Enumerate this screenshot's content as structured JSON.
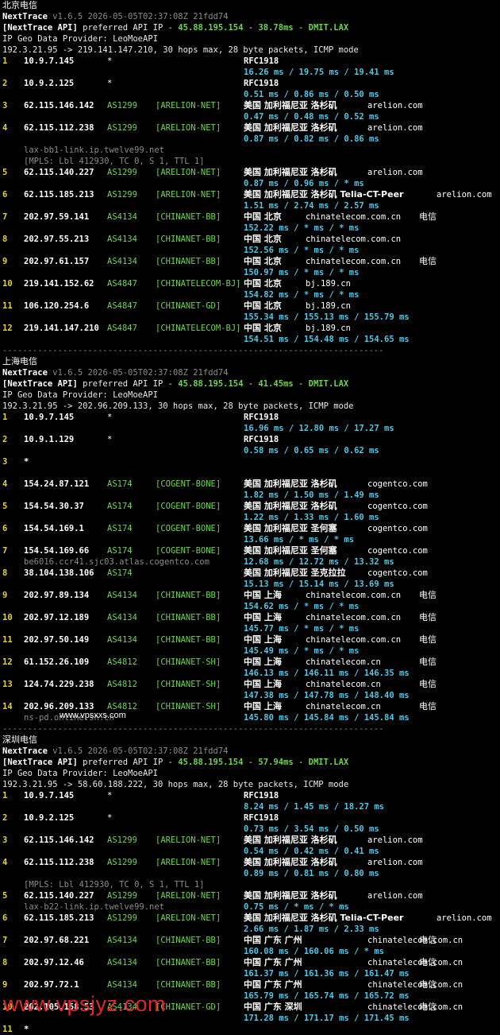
{
  "watermark_top": "www.vpsxxs.com",
  "watermark_bottom": "www.vpsjyz.com",
  "sections": [
    {
      "name": "北京电信",
      "version_line": "v1.6.5 2026-05-05T02:37:08Z 21fdd74",
      "api_ip": "45.88.195.154",
      "api_latency": "38.78ms",
      "api_node": "DMIT.LAX",
      "geo": "IP Geo Data Provider: LeoMoeAPI",
      "target": "192.3.21.95 -> 219.141.147.210, 30 hops max, 28 byte packets, ICMP mode",
      "hops": [
        {
          "n": "1",
          "ip": "10.9.7.145",
          "as": "*",
          "net": "",
          "loc": "RFC1918",
          "dom": "",
          "isp": "",
          "rtt": "16.26 ms / 19.75 ms / 19.41 ms",
          "extra": []
        },
        {
          "n": "2",
          "ip": "10.9.2.125",
          "as": "*",
          "net": "",
          "loc": "RFC1918",
          "dom": "",
          "isp": "",
          "rtt": "0.51 ms / 0.86 ms / 0.50 ms",
          "extra": []
        },
        {
          "n": "3",
          "ip": "62.115.146.142",
          "as": "AS1299",
          "net": "[ARELION-NET]",
          "loc": "美国 加利福尼亚 洛杉矶",
          "dom": "arelion.com",
          "isp": "",
          "rtt": "0.47 ms / 0.48 ms / 0.52 ms",
          "extra": []
        },
        {
          "n": "4",
          "ip": "62.115.112.238",
          "as": "AS1299",
          "net": "[ARELION-NET]",
          "loc": "美国 加利福尼亚 洛杉矶",
          "dom": "arelion.com",
          "isp": "",
          "rtt": "0.87 ms / 0.82 ms / 0.86 ms",
          "extra": [
            "lax-bb1-link.ip.twelve99.net",
            "[MPLS: Lbl 412930, TC 0, S 1, TTL 1]"
          ]
        },
        {
          "n": "5",
          "ip": "62.115.140.227",
          "as": "AS1299",
          "net": "[ARELION-NET]",
          "loc": "美国 加利福尼亚 洛杉矶",
          "dom": "arelion.com",
          "isp": "",
          "rtt": "0.87 ms / 0.96 ms / * ms",
          "extra": []
        },
        {
          "n": "6",
          "ip": "62.115.185.213",
          "as": "AS1299",
          "net": "[ARELION-NET]",
          "loc": "美国 加利福尼亚 洛杉矶 Telia-CT-Peer",
          "dom": "arelion.com",
          "isp": "",
          "rtt": "1.51 ms / 2.74 ms / 2.57 ms",
          "extra": []
        },
        {
          "n": "7",
          "ip": "202.97.59.141",
          "as": "AS4134",
          "net": "[CHINANET-BB]",
          "loc": "中国 北京",
          "dom": "chinatelecom.com.cn",
          "isp": "电信",
          "rtt": "152.22 ms / * ms / * ms",
          "extra": []
        },
        {
          "n": "8",
          "ip": "202.97.55.213",
          "as": "AS4134",
          "net": "[CHINANET-BB]",
          "loc": "中国 北京",
          "dom": "chinatelecom.com.cn",
          "isp": "",
          "rtt": "152.56 ms / * ms / * ms",
          "extra": []
        },
        {
          "n": "9",
          "ip": "202.97.61.157",
          "as": "AS4134",
          "net": "[CHINANET-BB]",
          "loc": "中国 北京",
          "dom": "chinatelecom.com.cn",
          "isp": "电信",
          "rtt": "150.97 ms / * ms / * ms",
          "extra": []
        },
        {
          "n": "10",
          "ip": "219.141.152.62",
          "as": "AS4847",
          "net": "[CHINATELECOM-BJ]",
          "loc": "中国 北京",
          "dom": "bj.189.cn",
          "isp": "",
          "rtt": "154.82 ms / * ms / * ms",
          "extra": []
        },
        {
          "n": "11",
          "ip": "106.120.254.6",
          "as": "AS4847",
          "net": "[CHINANET-GD]",
          "loc": "中国 北京",
          "dom": "bj.189.cn",
          "isp": "",
          "rtt": "155.34 ms / 155.13 ms / 155.79 ms",
          "extra": []
        },
        {
          "n": "12",
          "ip": "219.141.147.210",
          "as": "AS4847",
          "net": "[CHINATELECOM-BJ]",
          "loc": "中国 北京",
          "dom": "bj.189.cn",
          "isp": "",
          "rtt": "154.51 ms / 154.48 ms / 154.65 ms",
          "extra": []
        }
      ]
    },
    {
      "name": "上海电信",
      "version_line": "v1.6.5 2026-05-05T02:37:08Z 21fdd74",
      "api_ip": "45.88.195.154",
      "api_latency": "41.45ms",
      "api_node": "DMIT.LAX",
      "geo": "IP Geo Data Provider: LeoMoeAPI",
      "target": "192.3.21.95 -> 202.96.209.133, 30 hops max, 28 byte packets, ICMP mode",
      "hops": [
        {
          "n": "1",
          "ip": "10.9.7.145",
          "as": "*",
          "net": "",
          "loc": "RFC1918",
          "dom": "",
          "isp": "",
          "rtt": "16.96 ms / 12.80 ms / 17.27 ms",
          "extra": []
        },
        {
          "n": "2",
          "ip": "10.9.1.129",
          "as": "*",
          "net": "",
          "loc": "RFC1918",
          "dom": "",
          "isp": "",
          "rtt": "0.58 ms / 0.65 ms / 0.62 ms",
          "extra": []
        },
        {
          "n": "3",
          "ip": "*",
          "as": "",
          "net": "",
          "loc": "",
          "dom": "",
          "isp": "",
          "rtt": "",
          "extra": []
        },
        {
          "n": "4",
          "ip": "154.24.87.121",
          "as": "AS174",
          "net": "[COGENT-BONE]",
          "loc": "美国 加利福尼亚 洛杉矶",
          "dom": "cogentco.com",
          "isp": "",
          "rtt": "1.82 ms / 1.50 ms / 1.49 ms",
          "extra": []
        },
        {
          "n": "5",
          "ip": "154.54.30.37",
          "as": "AS174",
          "net": "[COGENT-BONE]",
          "loc": "美国 加利福尼亚 洛杉矶",
          "dom": "cogentco.com",
          "isp": "",
          "rtt": "1.22 ms / 1.33 ms / 1.60 ms",
          "extra": []
        },
        {
          "n": "6",
          "ip": "154.54.169.1",
          "as": "AS174",
          "net": "[COGENT-BONE]",
          "loc": "美国 加利福尼亚 圣何塞",
          "dom": "cogentco.com",
          "isp": "",
          "rtt": "13.66 ms / * ms / * ms",
          "extra": []
        },
        {
          "n": "7",
          "ip": "154.54.169.66",
          "as": "AS174",
          "net": "[COGENT-BONE]",
          "loc": "美国 加利福尼亚 圣何塞",
          "dom": "cogentco.com",
          "isp": "",
          "rtt": "12.68 ms / 12.72 ms / 13.32 ms",
          "extra": [
            "be6016.ccr41.sjc03.atlas.cogentco.com"
          ],
          "extra_inline": true
        },
        {
          "n": "8",
          "ip": "38.104.138.106",
          "as": "AS174",
          "net": "",
          "loc": "美国 加利福尼亚 圣克拉拉",
          "dom": "cogentco.com",
          "isp": "",
          "rtt": "15.13 ms / 15.14 ms / 13.69 ms",
          "extra": []
        },
        {
          "n": "9",
          "ip": "202.97.89.134",
          "as": "AS4134",
          "net": "[CHINANET-BB]",
          "loc": "中国 上海",
          "dom": "chinatelecom.com.cn",
          "isp": "电信",
          "rtt": "154.62 ms / * ms / * ms",
          "extra": []
        },
        {
          "n": "10",
          "ip": "202.97.12.189",
          "as": "AS4134",
          "net": "[CHINANET-BB]",
          "loc": "中国 上海",
          "dom": "chinatelecom.com.cn",
          "isp": "电信",
          "rtt": "145.77 ms / * ms / * ms",
          "extra": []
        },
        {
          "n": "11",
          "ip": "202.97.50.149",
          "as": "AS4134",
          "net": "[CHINANET-BB]",
          "loc": "中国 上海",
          "dom": "chinatelecom.com.cn",
          "isp": "电信",
          "rtt": "145.49 ms / * ms / * ms",
          "extra": []
        },
        {
          "n": "12",
          "ip": "61.152.26.109",
          "as": "AS4812",
          "net": "[CHINANET-SH]",
          "loc": "中国 上海",
          "dom": "chinatelecom.cn",
          "isp": "电信",
          "rtt": "146.13 ms / 146.11 ms / 146.35 ms",
          "extra": []
        },
        {
          "n": "13",
          "ip": "124.74.229.238",
          "as": "AS4812",
          "net": "[CHINANET-SH]",
          "loc": "中国 上海",
          "dom": "chinatelecom.cn",
          "isp": "电信",
          "rtt": "147.38 ms / 147.78 ms / 148.40 ms",
          "extra": []
        },
        {
          "n": "14",
          "ip": "202.96.209.133",
          "as": "AS4812",
          "net": "[CHINANET-SH]",
          "loc": "中国 上海",
          "dom": "chinatelecom.cn",
          "isp": "电信",
          "rtt": "145.80 ms / 145.84 ms / 145.84 ms",
          "extra": [
            "ns-pd.online.sh.cn"
          ],
          "extra_inline": true
        }
      ]
    },
    {
      "name": "深圳电信",
      "version_line": "v1.6.5 2026-05-05T02:37:08Z 21fdd74",
      "api_ip": "45.88.195.154",
      "api_latency": "57.94ms",
      "api_node": "DMIT.LAX",
      "geo": "IP Geo Data Provider: LeoMoeAPI",
      "target": "192.3.21.95 -> 58.60.188.222, 30 hops max, 28 byte packets, ICMP mode",
      "hops": [
        {
          "n": "1",
          "ip": "10.9.7.145",
          "as": "*",
          "net": "",
          "loc": "RFC1918",
          "dom": "",
          "isp": "",
          "rtt": "8.24 ms / 1.45 ms / 18.27 ms",
          "extra": []
        },
        {
          "n": "2",
          "ip": "10.9.2.125",
          "as": "*",
          "net": "",
          "loc": "RFC1918",
          "dom": "",
          "isp": "",
          "rtt": "0.73 ms / 3.54 ms / 0.50 ms",
          "extra": []
        },
        {
          "n": "3",
          "ip": "62.115.146.142",
          "as": "AS1299",
          "net": "[ARELION-NET]",
          "loc": "美国 加利福尼亚 洛杉矶",
          "dom": "arelion.com",
          "isp": "",
          "rtt": "0.54 ms / 0.42 ms / 0.41 ms",
          "extra": []
        },
        {
          "n": "4",
          "ip": "62.115.112.238",
          "as": "AS1299",
          "net": "[ARELION-NET]",
          "loc": "美国 加利福尼亚 洛杉矶",
          "dom": "arelion.com",
          "isp": "",
          "rtt": "0.89 ms / 0.81 ms / 0.80 ms",
          "extra": []
        },
        {
          "n": "",
          "ip": "",
          "as": "",
          "net": "",
          "loc": "",
          "dom": "",
          "isp": "",
          "rtt": "",
          "extra": [
            "[MPLS: Lbl 412930, TC 0, S 1, TTL 1]"
          ],
          "extra_only": true
        },
        {
          "n": "5",
          "ip": "62.115.140.227",
          "as": "AS1299",
          "net": "[ARELION-NET]",
          "loc": "美国 加利福尼亚 洛杉矶",
          "dom": "arelion.com",
          "isp": "",
          "rtt": "0.75 ms / * ms / * ms",
          "extra": [
            "lax-b22-link.ip.twelve99.net"
          ],
          "extra_inline": true
        },
        {
          "n": "6",
          "ip": "62.115.185.213",
          "as": "AS1299",
          "net": "[ARELION-NET]",
          "loc": "美国 加利福尼亚 洛杉矶 Telia-CT-Peer",
          "dom": "arelion.com",
          "isp": "",
          "rtt": "2.66 ms / 1.87 ms / 2.33 ms",
          "extra": []
        },
        {
          "n": "7",
          "ip": "202.97.68.221",
          "as": "AS4134",
          "net": "[CHINANET-BB]",
          "loc": "中国 广东 广州",
          "dom": "chinatelecom.com.cn",
          "isp": "电信",
          "rtt": "160.08 ms / 160.06 ms / * ms",
          "extra": []
        },
        {
          "n": "8",
          "ip": "202.97.12.46",
          "as": "AS4134",
          "net": "[CHINANET-BB]",
          "loc": "中国 广东 广州",
          "dom": "chinatelecom.com.cn",
          "isp": "电信",
          "rtt": "161.37 ms / 161.36 ms / 161.47 ms",
          "extra": []
        },
        {
          "n": "9",
          "ip": "202.97.72.1",
          "as": "AS4134",
          "net": "[CHINANET-BB]",
          "loc": "中国 广东 广州",
          "dom": "chinatelecom.com.cn",
          "isp": "电信",
          "rtt": "165.79 ms / 165.74 ms / 165.72 ms",
          "extra": []
        },
        {
          "n": "10",
          "ip": "202.105.158.53",
          "as": "AS4134",
          "net": "[CHINANET-GD]",
          "loc": "中国 广东 深圳",
          "dom": "chinatelecom.com.cn",
          "isp": "电信",
          "rtt": "171.28 ms / 171.17 ms / 171.45 ms",
          "extra": []
        },
        {
          "n": "11",
          "ip": "*",
          "as": "",
          "net": "",
          "loc": "",
          "dom": "",
          "isp": "",
          "rtt": "",
          "extra": []
        }
      ]
    }
  ],
  "labels": {
    "nexttrace": "NextTrace",
    "api_prefix": "[NextTrace API]",
    "api_mid": " preferred API IP - ",
    "dash": " - ",
    "separator": "----------------------------------------------------------------------------"
  }
}
